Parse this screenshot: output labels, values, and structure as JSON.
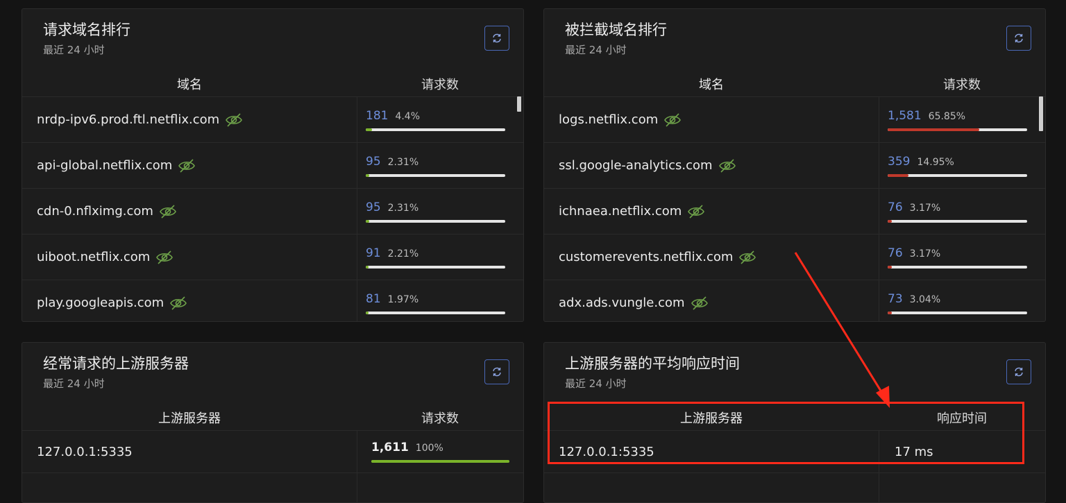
{
  "colors": {
    "accent": "#4a68b8",
    "green_bar": "#7ab32a",
    "red_bar": "#c0392b",
    "highlight": "#ff2a1a"
  },
  "cards": [
    {
      "title": "请求域名排行",
      "subtitle": "最近 24 小时",
      "col1": "域名",
      "col2": "请求数",
      "rows": [
        {
          "domain": "nrdp-ipv6.prod.ftl.netflix.com",
          "count": "181",
          "pct": "4.4%",
          "ratio": 0.044
        },
        {
          "domain": "api-global.netflix.com",
          "count": "95",
          "pct": "2.31%",
          "ratio": 0.0231
        },
        {
          "domain": "cdn-0.nflximg.com",
          "count": "95",
          "pct": "2.31%",
          "ratio": 0.0231
        },
        {
          "domain": "uiboot.netflix.com",
          "count": "91",
          "pct": "2.21%",
          "ratio": 0.0221
        },
        {
          "domain": "play.googleapis.com",
          "count": "81",
          "pct": "1.97%",
          "ratio": 0.0197
        }
      ]
    },
    {
      "title": "被拦截域名排行",
      "subtitle": "最近 24 小时",
      "col1": "域名",
      "col2": "请求数",
      "rows": [
        {
          "domain": "logs.netflix.com",
          "count": "1,581",
          "pct": "65.85%",
          "ratio": 0.6585
        },
        {
          "domain": "ssl.google-analytics.com",
          "count": "359",
          "pct": "14.95%",
          "ratio": 0.1495
        },
        {
          "domain": "ichnaea.netflix.com",
          "count": "76",
          "pct": "3.17%",
          "ratio": 0.0317
        },
        {
          "domain": "customerevents.netflix.com",
          "count": "76",
          "pct": "3.17%",
          "ratio": 0.0317
        },
        {
          "domain": "adx.ads.vungle.com",
          "count": "73",
          "pct": "3.04%",
          "ratio": 0.0304
        }
      ]
    },
    {
      "title": "经常请求的上游服务器",
      "subtitle": "最近 24 小时",
      "col1": "上游服务器",
      "col2": "请求数",
      "rows": [
        {
          "server": "127.0.0.1:5335",
          "count": "1,611",
          "pct": "100%",
          "ratio": 1.0
        }
      ]
    },
    {
      "title": "上游服务器的平均响应时间",
      "subtitle": "最近 24 小时",
      "col1": "上游服务器",
      "col2": "响应时间",
      "rows": [
        {
          "server": "127.0.0.1:5335",
          "time": "17 ms"
        }
      ]
    }
  ]
}
